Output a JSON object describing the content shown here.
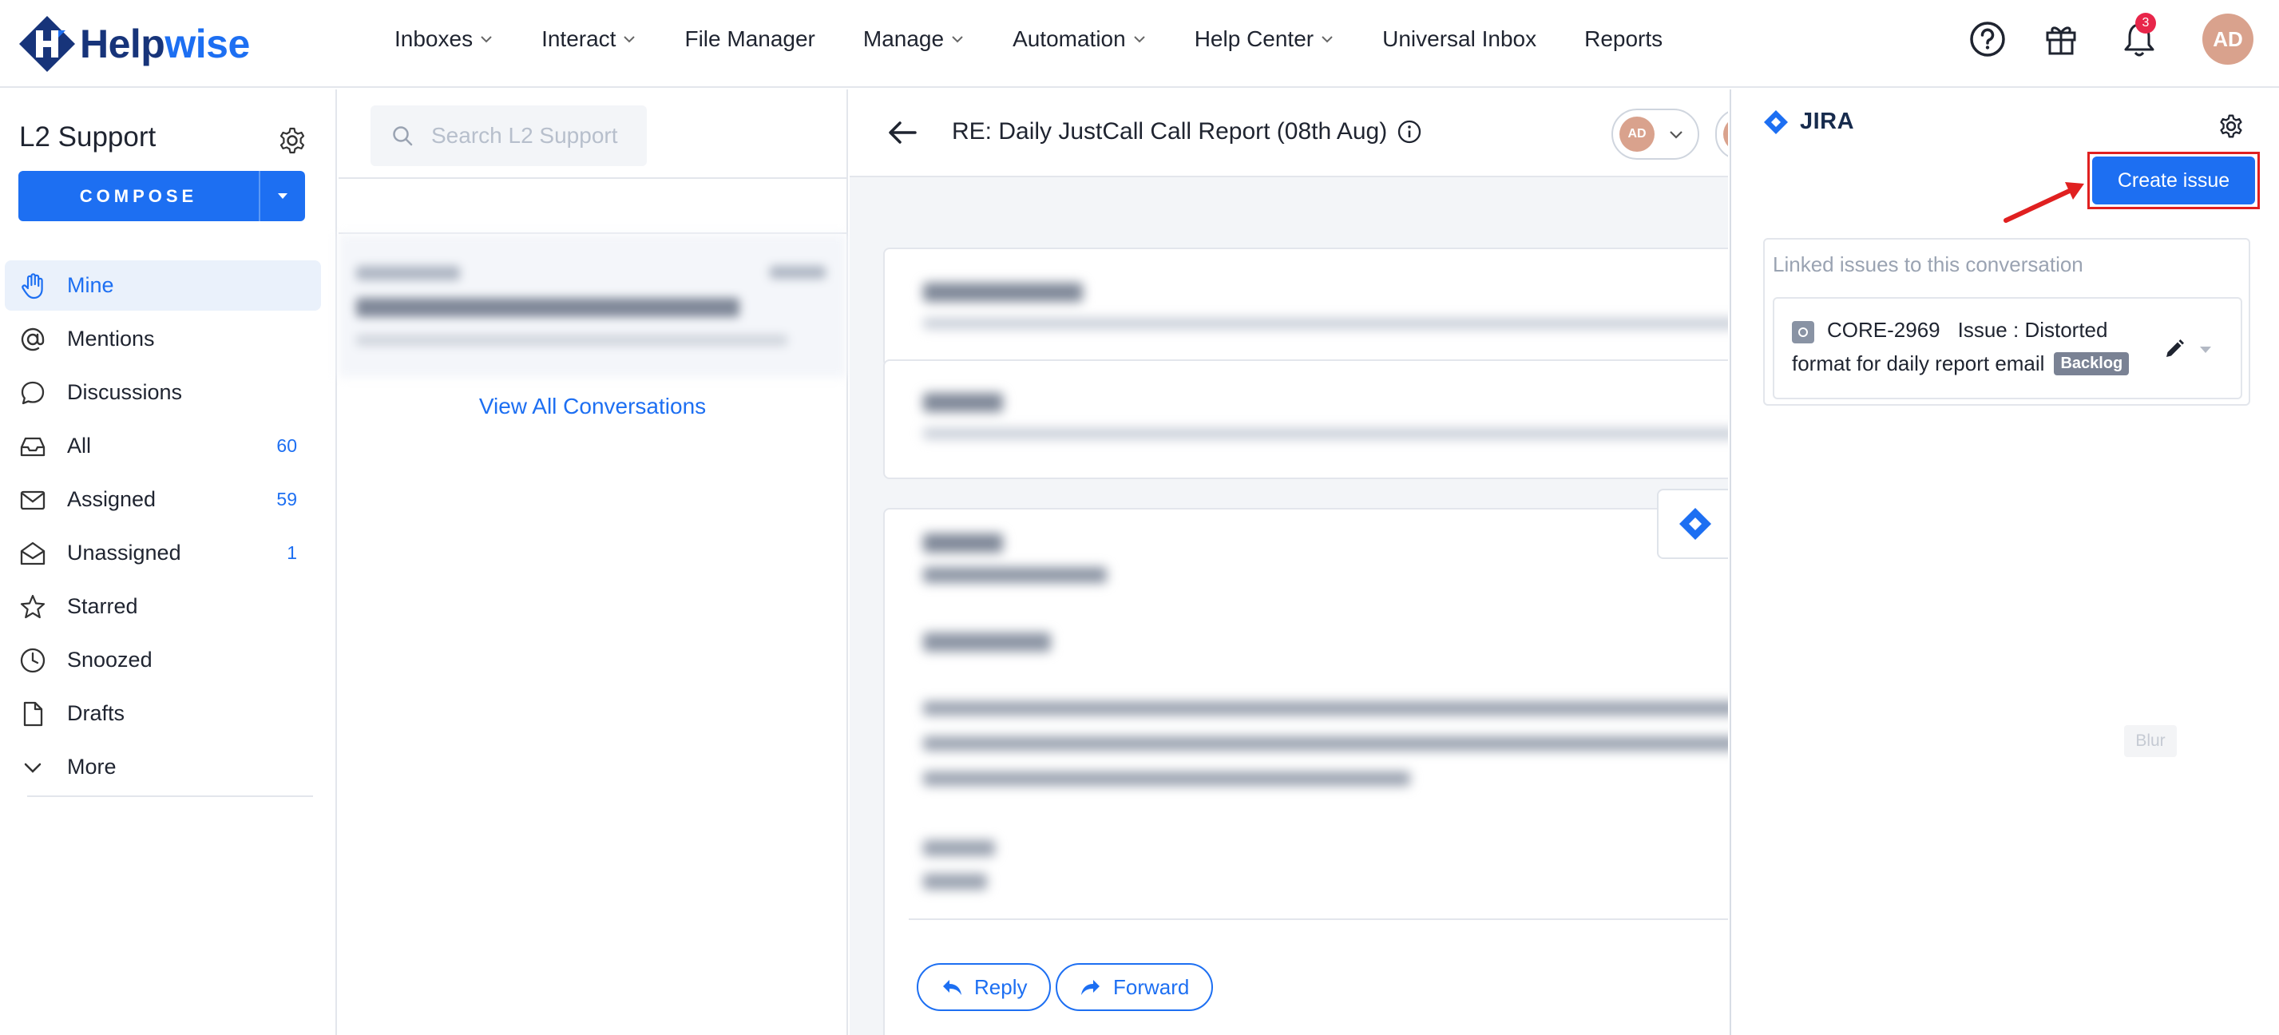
{
  "brand": {
    "name_part1": "Help",
    "name_part2": "wise",
    "accent_color": "#1d6ff2",
    "dark_color": "#17347a"
  },
  "nav": {
    "items": [
      {
        "label": "Inboxes",
        "dropdown": true
      },
      {
        "label": "Interact",
        "dropdown": true
      },
      {
        "label": "File Manager",
        "dropdown": false
      },
      {
        "label": "Manage",
        "dropdown": true
      },
      {
        "label": "Automation",
        "dropdown": true
      },
      {
        "label": "Help Center",
        "dropdown": true
      },
      {
        "label": "Universal Inbox",
        "dropdown": false
      },
      {
        "label": "Reports",
        "dropdown": false
      }
    ],
    "icons": [
      "help-circle-icon",
      "gift-icon",
      "bell-icon"
    ],
    "notification_count": "3",
    "user_initials": "AD"
  },
  "sidebar": {
    "inbox_title": "L2 Support",
    "compose_label": "COMPOSE",
    "items": [
      {
        "label": "Mine",
        "count": "",
        "icon": "hand-icon",
        "active": true
      },
      {
        "label": "Mentions",
        "count": "",
        "icon": "at-icon",
        "active": false
      },
      {
        "label": "Discussions",
        "count": "",
        "icon": "chat-bubble-icon",
        "active": false
      },
      {
        "label": "All",
        "count": "60",
        "icon": "inbox-icon",
        "active": false
      },
      {
        "label": "Assigned",
        "count": "59",
        "icon": "envelope-icon",
        "active": false
      },
      {
        "label": "Unassigned",
        "count": "1",
        "icon": "envelope-open-icon",
        "active": false
      },
      {
        "label": "Starred",
        "count": "",
        "icon": "star-icon",
        "active": false
      },
      {
        "label": "Snoozed",
        "count": "",
        "icon": "clock-icon",
        "active": false
      },
      {
        "label": "Drafts",
        "count": "",
        "icon": "document-icon",
        "active": false
      },
      {
        "label": "More",
        "count": "",
        "icon": "chevron-down-icon",
        "active": false
      }
    ]
  },
  "conversation_list": {
    "search_placeholder": "Search L2 Support",
    "view_all_label": "View All Conversations"
  },
  "conversation": {
    "subject": "RE: Daily JustCall Call Report (08th Aug)",
    "assignee_initials": "AD",
    "reply_label": "Reply",
    "forward_label": "Forward"
  },
  "jira": {
    "title": "JIRA",
    "create_label": "Create issue",
    "linked_title": "Linked issues to this conversation",
    "issue": {
      "key": "CORE-2969",
      "summary_line1": "Issue : Distorted",
      "summary_line2": "format for daily report email",
      "status": "Backlog"
    },
    "blur_tag": "Blur"
  }
}
